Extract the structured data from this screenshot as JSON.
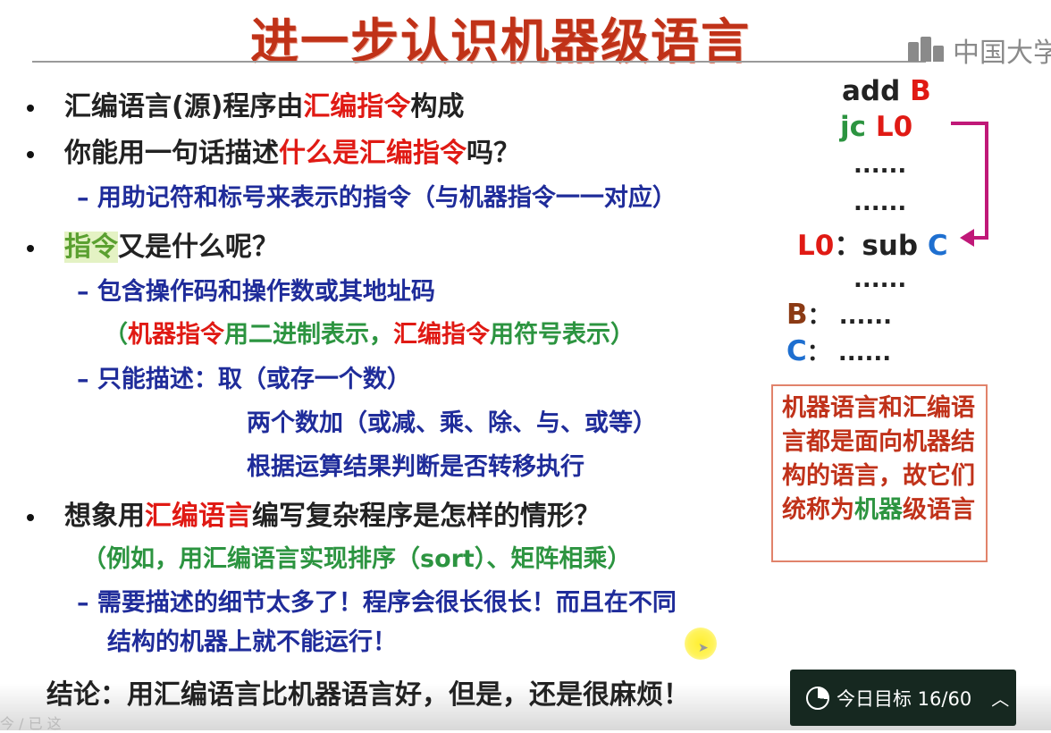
{
  "slide": {
    "title": "进一步认识机器级语言",
    "logo_text": "中国大学",
    "bullet1": {
      "a": "汇编语言(源)程序由",
      "b": "汇编指令",
      "c": "构成"
    },
    "bullet2": {
      "a": "你能用一句话描述",
      "b": "什么是汇编指令",
      "c": "吗？"
    },
    "bullet2_sub": "– 用助记符和标号来表示的指令（与机器指令一一对应）",
    "bullet3": {
      "a": "指令",
      "b": "又是什么呢？"
    },
    "bullet3_sub1": "– 包含操作码和操作数或其地址码",
    "bullet3_sub1b": {
      "p1": "（",
      "a": "机器指令",
      "b": "用二进制表示，",
      "c": "汇编指令",
      "d": "用符号表示）"
    },
    "bullet3_sub2": "– 只能描述：取（或存一个数）",
    "bullet3_sub2b": "两个数加（或减、乘、除、与、或等）",
    "bullet3_sub2c": "根据运算结果判断是否转移执行",
    "bullet4": {
      "a": "想象用",
      "b": "汇编语言",
      "c": "编写复杂程序是怎样的情形？"
    },
    "bullet4_example": "（例如，用汇编语言实现排序（sort）、矩阵相乘）",
    "bullet4_sub1": "– 需要描述的细节太多了！程序会很长很长！而且在不同",
    "bullet4_sub2": "结构的机器上就不能运行！",
    "conclusion": "结论：用汇编语言比机器语言好，但是，还是很麻烦！",
    "code": {
      "l1a": "add",
      "l1b": "B",
      "l2a": "jc",
      "l2b": "L0",
      "dots": "......",
      "l5a": "L0",
      "l5b": "：sub",
      "l5c": "C",
      "l7a": "B",
      "l7b": "：  ......",
      "l8a": "C",
      "l8b": "：  ......"
    },
    "note": {
      "a": "机器语言和汇编语言都是面向机器结构的语言，故它们统称为",
      "b": "机器",
      "c": "级语言"
    },
    "prompt_fragment": "今 / 已 这"
  },
  "goal_widget": {
    "label": "今日目标 16/60",
    "progress": 0.267
  },
  "colors": {
    "title": "#c03218",
    "red": "#e01a14",
    "green": "#2c9440",
    "navy": "#1f2c9a",
    "blue": "#1e6fd0",
    "brown": "#8b3a14",
    "widget_bg": "#162820"
  }
}
